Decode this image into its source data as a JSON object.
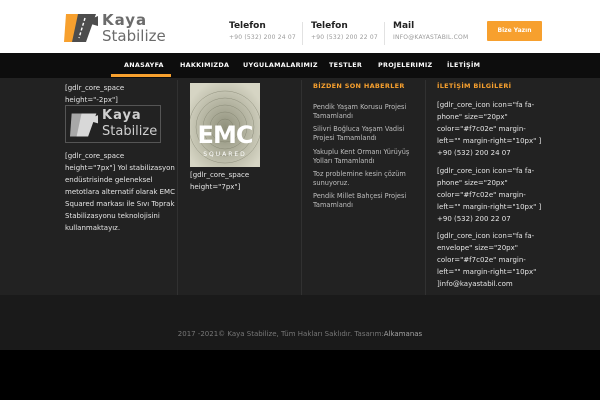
{
  "logo": {
    "line1": "Kaya",
    "line2": "Stabilize"
  },
  "contacts": [
    {
      "title": "Telefon",
      "value": "+90 (532) 200 24 07"
    },
    {
      "title": "Telefon",
      "value": "+90 (532) 200 22 07"
    },
    {
      "title": "Mail",
      "value": "INFO@KAYASTABIL.COM"
    }
  ],
  "cta": {
    "label": "Bize Yazın"
  },
  "nav": {
    "items": [
      "ANASAYFA",
      "HAKKIMIZDA",
      "UYGULAMALARIMIZ",
      "TESTLER",
      "PROJELERIMIZ",
      "İLETİŞİM"
    ],
    "active": "ANASAYFA"
  },
  "col1": {
    "space1": "[gdlr_core_space height=\"-2px\"]",
    "logo_line1": "Kaya",
    "logo_line2": "Stabilize",
    "text": "[gdlr_core_space height=\"7px\"] Yol stabilizasyon endüstrisinde geleneksel metotlara alternatif olarak EMC Squared markası ile Sıvı Toprak Stabilizasyonu teknolojisini kullanmaktayız."
  },
  "col2": {
    "emc_label": "EMC",
    "emc_sub": "SQUARED",
    "space": "[gdlr_core_space height=\"7px\"]"
  },
  "col3": {
    "title": "BİZDEN SON HABERLER",
    "news": [
      "Pendik Yaşam Korusu Projesi Tamamlandı",
      "Silivri Boğluca Yaşam Vadisi Projesi Tamamlandı",
      "Yakuplu Kent Ormanı Yürüyüş Yolları Tamamlandı",
      "Toz problemine kesin çözüm sunuyoruz.",
      "Pendik Millet Bahçesi Projesi Tamamlandı"
    ]
  },
  "col4": {
    "title": "İLETİŞİM BİLGİLERİ",
    "blocks": [
      "[gdlr_core_icon icon=\"fa fa-phone\" size=\"20px\" color=\"#f7c02e\" margin-left=\"\" margin-right=\"10px\" ] +90 (532) 200 24 07",
      "[gdlr_core_icon icon=\"fa fa-phone\" size=\"20px\" color=\"#f7c02e\" margin-left=\"\" margin-right=\"10px\" ] +90 (532) 200 22 07",
      "[gdlr_core_icon icon=\"fa fa-envelope\" size=\"20px\" color=\"#f7c02e\" margin-left=\"\" margin-right=\"10px\" ]info@kayastabil.com"
    ]
  },
  "footer": {
    "copyright": "2017 -2021© Kaya Stabilize, Tüm Hakları Saklıdır. Tasarım:",
    "designer": "Alkamanas"
  },
  "colors": {
    "accent": "#f7a02e",
    "dark": "#222222",
    "nav": "#0d0d0d"
  }
}
